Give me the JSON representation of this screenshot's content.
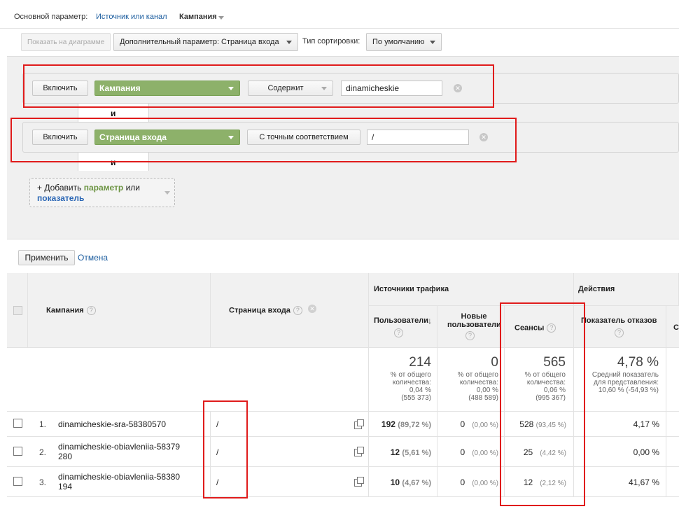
{
  "primary": {
    "label": "Основной параметр:",
    "link": "Источник или канал",
    "current": "Кампания"
  },
  "toolbar": {
    "show_on_chart": "Показать на диаграмме",
    "secondary_dim": "Дополнительный параметр: Страница входа",
    "sort_label": "Тип сортировки:",
    "sort_value": "По умолчанию"
  },
  "filters": {
    "rows": [
      {
        "include": "Включить",
        "dimension": "Кампания",
        "match": "Содержит",
        "value": "dinamicheskie"
      },
      {
        "include": "Включить",
        "dimension": "Страница входа",
        "match": "С точным соответствием",
        "value": "/"
      }
    ],
    "and_label": "и",
    "add_prefix": "+ Добавить",
    "add_param": "параметр",
    "add_or": "или",
    "add_metric": "показатель",
    "apply": "Применить",
    "cancel": "Отмена"
  },
  "table": {
    "col_campaign": "Кампания",
    "col_landing": "Страница входа",
    "group_traffic": "Источники трафика",
    "group_actions": "Действия",
    "col_users": "Пользователи",
    "col_new_users": "Новые пользователи",
    "col_sessions": "Сеансы",
    "col_bounce": "Показатель отказов",
    "col_cut": "С",
    "totals": {
      "users": "214",
      "users_sub": [
        "% от общего",
        "количества:",
        "0,04 %",
        "(555 373)"
      ],
      "new_users": "0",
      "new_users_sub": [
        "% от общего",
        "количества:",
        "0,00 %",
        "(488 589)"
      ],
      "sessions": "565",
      "sessions_sub": [
        "% от общего",
        "количества:",
        "0,06 %",
        "(995 367)"
      ],
      "bounce": "4,78 %",
      "bounce_sub": [
        "Средний показатель",
        "для представления:",
        "10,60 % (-54,93 %)"
      ]
    },
    "rows": [
      {
        "num": "1.",
        "campaign": "dinamicheskie-sra-58380570",
        "landing": "/",
        "users": "192",
        "users_pct": "(89,72 %)",
        "new_users": "0",
        "new_users_pct": "(0,00 %)",
        "sessions": "528",
        "sessions_pct": "(93,45 %)",
        "bounce": "4,17 %"
      },
      {
        "num": "2.",
        "campaign": "dinamicheskie-obiavleniia-58379280",
        "landing": "/",
        "users": "12",
        "users_pct": "(5,61 %)",
        "new_users": "0",
        "new_users_pct": "(0,00 %)",
        "sessions": "25",
        "sessions_pct": "(4,42 %)",
        "bounce": "0,00 %"
      },
      {
        "num": "3.",
        "campaign": "dinamicheskie-obiavleniia-58380194",
        "landing": "/",
        "users": "10",
        "users_pct": "(4,67 %)",
        "new_users": "0",
        "new_users_pct": "(0,00 %)",
        "sessions": "12",
        "sessions_pct": "(2,12 %)",
        "bounce": "41,67 %"
      }
    ]
  },
  "colors": {
    "highlight": "#e01b1b",
    "green": "#8db16a",
    "link": "#1a5c9e"
  }
}
